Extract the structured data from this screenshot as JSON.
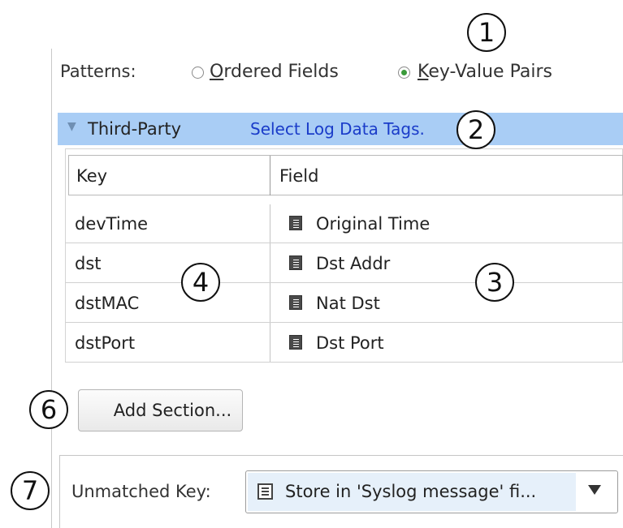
{
  "patterns": {
    "label": "Patterns:",
    "options": [
      {
        "mnemonic": "O",
        "rest": "rdered Fields",
        "selected": false
      },
      {
        "mnemonic": "K",
        "rest": "ey-Value Pairs",
        "selected": true
      }
    ]
  },
  "section": {
    "title": "Third-Party",
    "link": "Select Log Data Tags.",
    "expanded": true
  },
  "table": {
    "columns": [
      "Key",
      "Field"
    ],
    "rows": [
      {
        "key": "devTime",
        "field": "Original Time"
      },
      {
        "key": "dst",
        "field": "Dst Addr"
      },
      {
        "key": "dstMAC",
        "field": "Nat Dst"
      },
      {
        "key": "dstPort",
        "field": "Dst Port"
      }
    ]
  },
  "add_section_button": "Add Section...",
  "unmatched": {
    "label": "Unmatched Key:",
    "selected": "Store in 'Syslog message' fi..."
  },
  "callouts": [
    "1",
    "2",
    "3",
    "4",
    "6",
    "7"
  ],
  "colors": {
    "section_bar": "#a9cdf5",
    "link": "#1a3cc9",
    "radio_selected": "#3a9a3a",
    "combo_highlight": "#e6f0fa"
  }
}
